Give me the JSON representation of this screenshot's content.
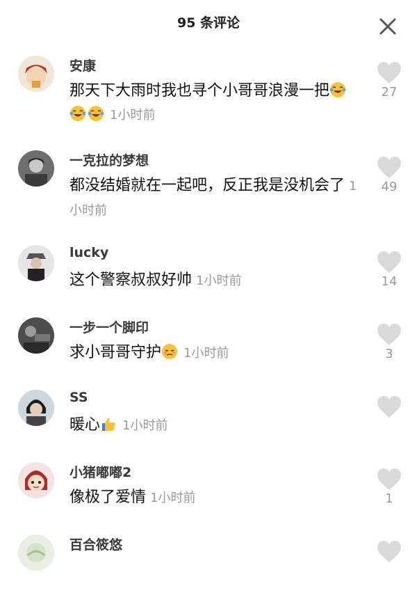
{
  "header": {
    "title": "95 条评论"
  },
  "comments": [
    {
      "user": "安康",
      "text": "那天下大雨时我也寻个小哥哥浪漫一把",
      "time": "1小时前",
      "likes": "27"
    },
    {
      "user": "一克拉的梦想",
      "text": "都没结婚就在一起吧，反正我是没机会了",
      "time": "1小时前",
      "likes": "49"
    },
    {
      "user": "lucky",
      "text": "这个警察叔叔好帅",
      "time": "1小时前",
      "likes": "14"
    },
    {
      "user": "一步一个脚印",
      "text": "求小哥哥守护",
      "time": "1小时前",
      "likes": "3"
    },
    {
      "user": "SS",
      "text": "暖心",
      "time": "1小时前",
      "likes": ""
    },
    {
      "user": "小猪嘟嘟2",
      "text": "像极了爱情",
      "time": "1小时前",
      "likes": "1"
    },
    {
      "user": "百合筱悠",
      "text": "",
      "time": "",
      "likes": ""
    }
  ],
  "colors": {
    "heart": "#d9d9d9",
    "meta": "#9a9a9a",
    "username": "#3a3a3a"
  }
}
